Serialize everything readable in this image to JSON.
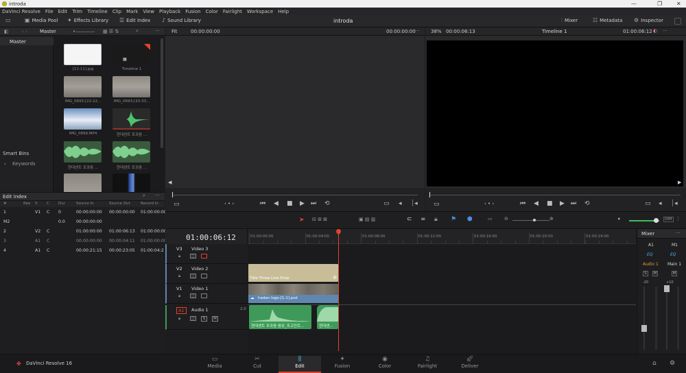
{
  "window": {
    "title": "introda"
  },
  "menu": [
    "DaVinci Resolve",
    "File",
    "Edit",
    "Trim",
    "Timeline",
    "Clip",
    "Mark",
    "View",
    "Playback",
    "Fusion",
    "Color",
    "Fairlight",
    "Workspace",
    "Help"
  ],
  "toolbar": {
    "media_pool": "Media Pool",
    "effects_library": "Effects Library",
    "edit_index": "Edit Index",
    "sound_library": "Sound Library",
    "project_title": "introda",
    "mixer": "Mixer",
    "metadata": "Metadata",
    "inspector": "Inspector"
  },
  "media_pool": {
    "bin_name": "Master",
    "sidebar_master": "Master",
    "smart_bins": "Smart Bins",
    "keywords": "Keywords",
    "clips": [
      {
        "name": "[11-11].jpg"
      },
      {
        "name": "Timeline 1"
      },
      {
        "name": "IMG_0693-[22-22..."
      },
      {
        "name": "IMG_0693-[33-33..."
      },
      {
        "name": "IMG_0899.MP4"
      },
      {
        "name": "현대센트 포과음 ..."
      },
      {
        "name": "현대센트 포과음 ..."
      },
      {
        "name": "현대센트 포과음 ..."
      },
      {
        "name": ""
      },
      {
        "name": ""
      }
    ]
  },
  "source_viewer": {
    "fit": "Fit",
    "tc_left": "00:00:00:00",
    "tc_right": "00:00:00:00"
  },
  "timeline_viewer": {
    "zoom": "38%",
    "duration": "00:00:06:13",
    "timeline_name": "Timeline 1",
    "timecode": "01:00:06:12"
  },
  "edit_index": {
    "title": "Edit Index",
    "columns": [
      "#",
      "Ree",
      "V",
      "C",
      "Dur",
      "Source In",
      "Source Out",
      "Record In"
    ],
    "rows": [
      {
        "n": "1",
        "reel": "",
        "v": "V1",
        "c": "C",
        "dur": "0",
        "src_in": "00:00:00:00",
        "src_out": "00:00:00:00",
        "rec_in": "01:00:00:00"
      },
      {
        "n": "M2",
        "reel": "",
        "v": "",
        "c": "",
        "dur": "0.0",
        "src_in": "00:00:00:00",
        "src_out": "",
        "rec_in": ""
      },
      {
        "n": "2",
        "reel": "",
        "v": "V2",
        "c": "C",
        "dur": "",
        "src_in": "01:00:00:00",
        "src_out": "01:00:06:13",
        "rec_in": "01:00:00:00"
      },
      {
        "n": "3",
        "reel": "",
        "v": "A1",
        "c": "C",
        "dur": "",
        "src_in": "00:00:00:00",
        "src_out": "00:00:04:11",
        "rec_in": "01:00:00:00"
      },
      {
        "n": "4",
        "reel": "",
        "v": "A1",
        "c": "C",
        "dur": "",
        "src_in": "00:00:21:15",
        "src_out": "00:00:23:05",
        "rec_in": "01:00:04:2"
      }
    ]
  },
  "timeline": {
    "timecode": "01:00:06:12",
    "ruler": [
      "01:00:00:00",
      "01:00:04:00",
      "01:00:08:00",
      "01:00:12:00",
      "01:00:16:00",
      "01:00:20:00",
      "01:00:24:00"
    ],
    "tracks": [
      {
        "id": "V3",
        "name": "Video 3"
      },
      {
        "id": "V2",
        "name": "Video 2"
      },
      {
        "id": "V1",
        "name": "Video 1"
      },
      {
        "id": "A1",
        "name": "Audio 1",
        "level": "2.0"
      }
    ],
    "clips": {
      "v2_title": "Title Three Line Drop",
      "v1": "hadan logo-[1-1].psd",
      "a1_clip1": "현대센트 포과음 음유_포고인트...",
      "a1_clip2": "현대센..."
    },
    "zoom_label": "DIM"
  },
  "mixer": {
    "title": "Mixer",
    "ch1": "A1",
    "ch2": "M1",
    "eq": "EQ",
    "audio1": "Audio 1",
    "main1": "Main 1",
    "s": "S",
    "m": "M",
    "db1": "-20",
    "db2": "+10"
  },
  "footer": {
    "app": "DaVinci Resolve 16",
    "pages": [
      "Media",
      "Cut",
      "Edit",
      "Fusion",
      "Color",
      "Fairlight",
      "Deliver"
    ],
    "active": "Edit"
  },
  "colors": {
    "accent": "#e5412f",
    "audio_clip": "#3f9a5a",
    "video_clip": "#5f87b0",
    "title_clip": "#c9bd98"
  }
}
